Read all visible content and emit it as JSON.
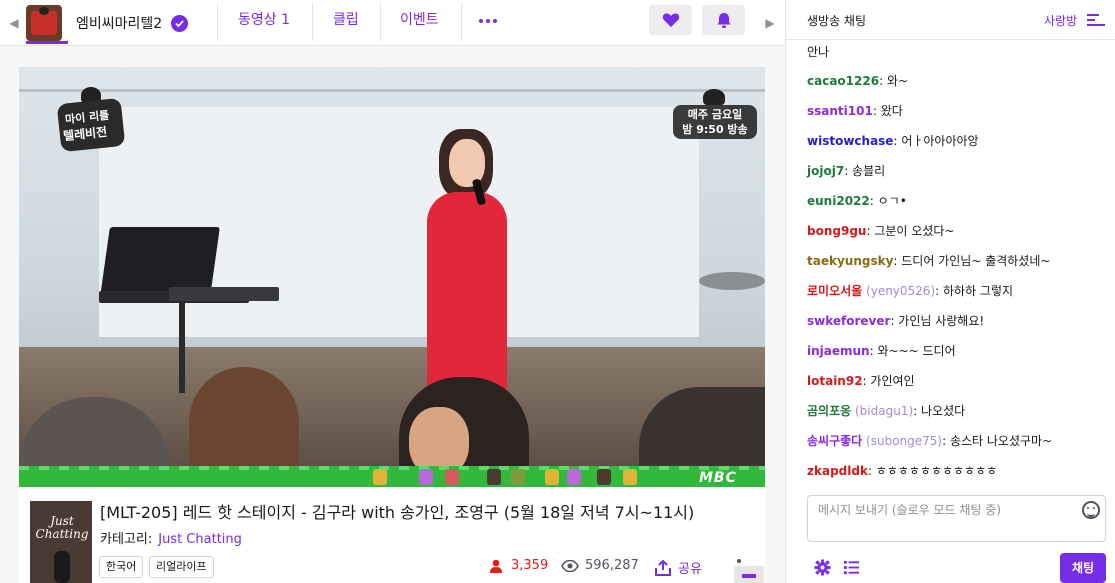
{
  "nav": {
    "channel_name": "엠비씨마리텔2",
    "tabs": [
      {
        "label": "동영상",
        "count": "1"
      },
      {
        "label": "클립"
      },
      {
        "label": "이벤트"
      }
    ]
  },
  "video": {
    "logo_line1": "마이 리틀",
    "logo_line2": "텔레비전",
    "airtime_line1": "매주 금요일",
    "airtime_line2": "밤 9:50 방송",
    "broadcaster": "MBC"
  },
  "info": {
    "title": "[MLT-205] 레드 핫 스테이지 - 김구라 with 송가인, 조영구 (5월 18일 저녁 7시~11시)",
    "category_label": "카테고리:",
    "category_value": "Just Chatting",
    "thumb_text": "Just Chatting",
    "tags": [
      "한국어",
      "리얼라이프"
    ],
    "viewers": "3,359",
    "views": "596,287",
    "share_label": "공유"
  },
  "chat": {
    "title": "생방송 채팅",
    "room_label": "사랑방",
    "top_fragment": "안나",
    "messages": [
      {
        "user": "cacao1226",
        "color": "#1e7a3c",
        "text": "와~"
      },
      {
        "user": "ssanti101",
        "color": "#8a2be2",
        "text": "왔다"
      },
      {
        "user": "wistowchase",
        "color": "#1f1fd6",
        "text": "어ㅏ아아아아앙"
      },
      {
        "user": "jojoj7",
        "color": "#1e7a3c",
        "text": "송블리"
      },
      {
        "user": "euni2022",
        "color": "#1e7a3c",
        "text": "ㅇㄱ•"
      },
      {
        "user": "bong9gu",
        "color": "#d11a1a",
        "text": "그분이 오셨다~"
      },
      {
        "user": "taekyungsky",
        "color": "#8a6b12",
        "text": "드디어 가인님~ 출격하셨네~"
      },
      {
        "user": "로미오서울",
        "id": "(yeny0526)",
        "color": "#d11a1a",
        "text": "하하하 그렇지"
      },
      {
        "user": "swkeforever",
        "color": "#8a2be2",
        "text": "가인님 사랑해요!"
      },
      {
        "user": "injaemun",
        "color": "#8a2be2",
        "text": "와~~~ 드디어"
      },
      {
        "user": "lotain92",
        "color": "#d11a1a",
        "text": "가인여인"
      },
      {
        "user": "곰의포옹",
        "id": "(bidagu1)",
        "color": "#1e7a3c",
        "text": "나오셨다"
      },
      {
        "user": "송씨구좋다",
        "id": "(subonge75)",
        "color": "#8a2be2",
        "text": "송스타 나오셨구마~"
      },
      {
        "user": "zkapdldk",
        "color": "#d11a1a",
        "text": "ㅎㅎㅎㅎㅎㅎㅎㅎㅎㅎㅎ"
      }
    ],
    "input_placeholder": "메시지 보내기 (슬로우 모드 채팅 중)",
    "send_label": "채팅"
  },
  "colors": {
    "accent": "#772ce8",
    "live_red": "#e91916"
  }
}
